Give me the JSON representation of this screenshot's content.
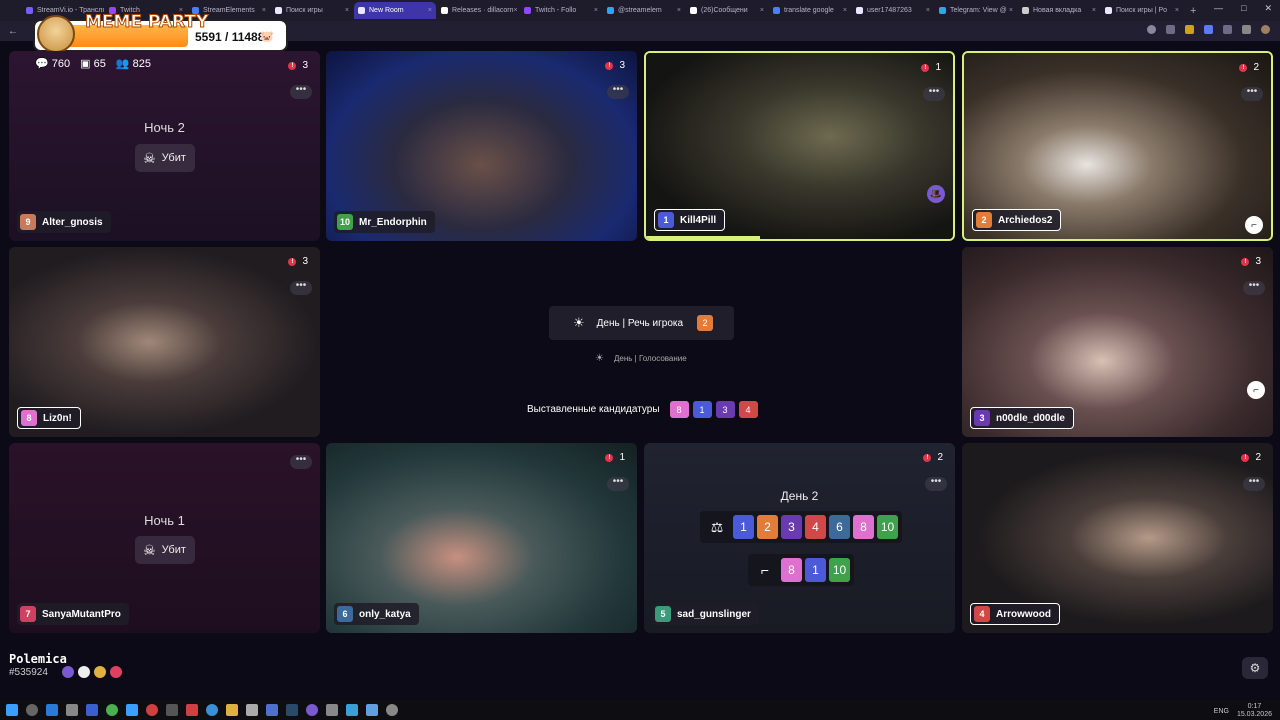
{
  "browser": {
    "tabs": [
      {
        "label": "StreamVi.io - Трансля",
        "color": "#7b5cff"
      },
      {
        "label": "Twitch",
        "color": "#9146ff"
      },
      {
        "label": "StreamElements",
        "color": "#4f7bff"
      },
      {
        "label": "Поиск игры",
        "color": "#e9e6ff"
      },
      {
        "label": "New Room",
        "color": "#e9e6ff",
        "active": true
      },
      {
        "label": "Releases · dillacorn",
        "color": "#ffffff"
      },
      {
        "label": "Twitch - Follo",
        "color": "#9146ff"
      },
      {
        "label": "@streamelem",
        "color": "#29a9eb"
      },
      {
        "label": "(26)Сообщени",
        "color": "#ffffff"
      },
      {
        "label": "translate google",
        "color": "#4f7bff"
      },
      {
        "label": "user17487263",
        "color": "#e9e6ff"
      },
      {
        "label": "Telegram: View @",
        "color": "#29a9eb"
      },
      {
        "label": "Новая вкладка",
        "color": "#cccccc"
      },
      {
        "label": "Поиск игры | Po",
        "color": "#e9e6ff"
      }
    ]
  },
  "meme": {
    "title": "MEME PARTY",
    "count": "5591 / 11488"
  },
  "stats": {
    "messages": "760",
    "live": "65",
    "viewers": "825"
  },
  "tiles": [
    {
      "player": "Alter_gnosis",
      "num": "9",
      "num_color": "#c97a5a",
      "fouls": "3",
      "night": "Ночь 2",
      "killed": "Убит"
    },
    {
      "player": "Mr_Endorphin",
      "num": "10",
      "num_color": "#3fa14a",
      "fouls": "3"
    },
    {
      "player": "Kill4Pill",
      "num": "1",
      "num_color": "#4a5ad8",
      "fouls": "1"
    },
    {
      "player": "Archiedos2",
      "num": "2",
      "num_color": "#e27c3a",
      "fouls": "2"
    },
    {
      "player": "Liz0n!",
      "num": "8",
      "num_color": "#e070d0",
      "fouls": "3"
    },
    {
      "player": "n00dle_d00dle",
      "num": "3",
      "num_color": "#6a3ab0",
      "fouls": "3"
    },
    {
      "player": "SanyaMutantPro",
      "num": "7",
      "num_color": "#d04060",
      "night": "Ночь 1",
      "killed": "Убит"
    },
    {
      "player": "only_katya",
      "num": "6",
      "num_color": "#3c6a9a",
      "fouls": "1"
    },
    {
      "player": "sad_gunslinger",
      "num": "5",
      "num_color": "#3a9a7a",
      "fouls": "2"
    },
    {
      "player": "Arrowwood",
      "num": "4",
      "num_color": "#d04848",
      "fouls": "2"
    }
  ],
  "game": {
    "phase": "День | Речь игрока",
    "phase_num": "2",
    "subphase": "День | Голосование",
    "candidates_label": "Выставленные кандидатуры",
    "candidates": [
      {
        "n": "8",
        "color": "#e070d0"
      },
      {
        "n": "1",
        "color": "#4a5ad8"
      },
      {
        "n": "3",
        "color": "#6a3ab0"
      },
      {
        "n": "4",
        "color": "#d04848"
      }
    ]
  },
  "votes_tile": {
    "title": "День 2",
    "row1": [
      {
        "n": "1",
        "color": "#4a5ad8"
      },
      {
        "n": "2",
        "color": "#e27c3a"
      },
      {
        "n": "3",
        "color": "#6a3ab0"
      },
      {
        "n": "4",
        "color": "#d04848"
      },
      {
        "n": "6",
        "color": "#3c6a9a"
      },
      {
        "n": "8",
        "color": "#e070d0"
      },
      {
        "n": "10",
        "color": "#3fa14a"
      }
    ],
    "row2": [
      {
        "n": "8",
        "color": "#e070d0"
      },
      {
        "n": "1",
        "color": "#4a5ad8"
      },
      {
        "n": "10",
        "color": "#3fa14a"
      }
    ]
  },
  "footer": {
    "title": "Polemica",
    "id": "#535924"
  },
  "taskbar": {
    "lang": "ENG",
    "time": "0:17",
    "date": "15.03.2026"
  }
}
